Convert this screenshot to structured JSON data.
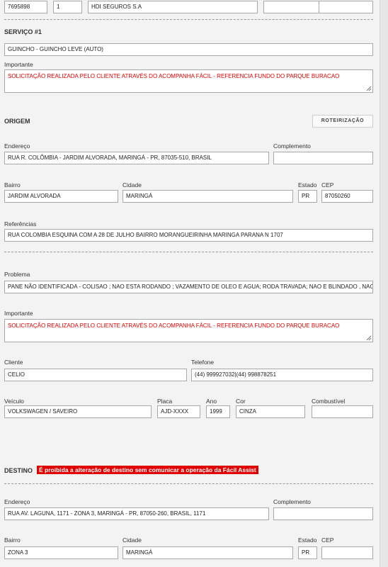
{
  "top": {
    "id": "7695898",
    "num": "1",
    "company": "HDI SEGUROS S.A",
    "extra1": "",
    "extra2": ""
  },
  "servico": {
    "title": "SERVIÇO #1",
    "value": "GUINCHO - GUINCHO LEVE (AUTO)",
    "importante_label": "Importante",
    "importante": "SOLICITAÇÃO REALIZADA PELO CLIENTE ATRAVÉS DO ACOMPANHA FÁCIL - REFERENCIA FUNDO DO PARQUE BURACAO"
  },
  "origem": {
    "title": "ORIGEM",
    "route_button": "ROTEIRIZAÇÃO",
    "labels": {
      "endereco": "Endereço",
      "complemento": "Complemento",
      "bairro": "Bairro",
      "cidade": "Cidade",
      "estado": "Estado",
      "cep": "CEP",
      "referencias": "Referências"
    },
    "endereco": "RUA R. COLÔMBIA - JARDIM ALVORADA, MARINGÁ - PR, 87035-510, BRASIL",
    "complemento": "",
    "bairro": "JARDIM ALVORADA",
    "cidade": "MARINGÁ",
    "estado": "PR",
    "cep": "87050260",
    "referencias": "RUA COLOMBIA ESQUINA COM A 28 DE JULHO  BAIRRO MORANGUEIRINHA MARINGA PARANA N 1707"
  },
  "problema": {
    "label": "Problema",
    "value": "PANE NÃO IDENTIFICADA - COLISAO ; NAO ESTA RODANDO ; VAZAMENTO DE OLEO E AGUA; RODA TRAVADA; NAO E BLINDADO , NAO E REB(",
    "importante_label": "Importante",
    "importante": "SOLICITAÇÃO REALIZADA PELO CLIENTE ATRAVÉS DO ACOMPANHA FÁCIL - REFERENCIA FUNDO DO PARQUE BURACAO"
  },
  "cliente": {
    "labels": {
      "cliente": "Cliente",
      "telefone": "Telefone"
    },
    "cliente": "CELIO",
    "telefone": "(44) 999927032|(44) 998878251"
  },
  "veiculo": {
    "labels": {
      "veiculo": "Veículo",
      "placa": "Placa",
      "ano": "Ano",
      "cor": "Cor",
      "combustivel": "Combustível"
    },
    "veiculo": "VOLKSWAGEN / SAVEIRO",
    "placa": "AJD-XXXX",
    "ano": "1999",
    "cor": "CINZA",
    "combustivel": ""
  },
  "destino": {
    "title": "DESTINO",
    "warning": "É proibida a alteração de destino sem comunicar a operação da Fácil Assist",
    "labels": {
      "endereco": "Endereço",
      "complemento": "Complemento",
      "bairro": "Bairro",
      "cidade": "Cidade",
      "estado": "Estado",
      "cep": "CEP"
    },
    "endereco": "RUA AV. LAGUNA, 1171 - ZONA 3, MARINGÁ - PR, 87050-260, BRASIL, 1171",
    "complemento": "",
    "bairro": "ZONA 3",
    "cidade": "MARINGÁ",
    "estado": "PR",
    "cep": ""
  },
  "colors": {
    "warning": "#e00000",
    "important_text": "#e00000"
  }
}
